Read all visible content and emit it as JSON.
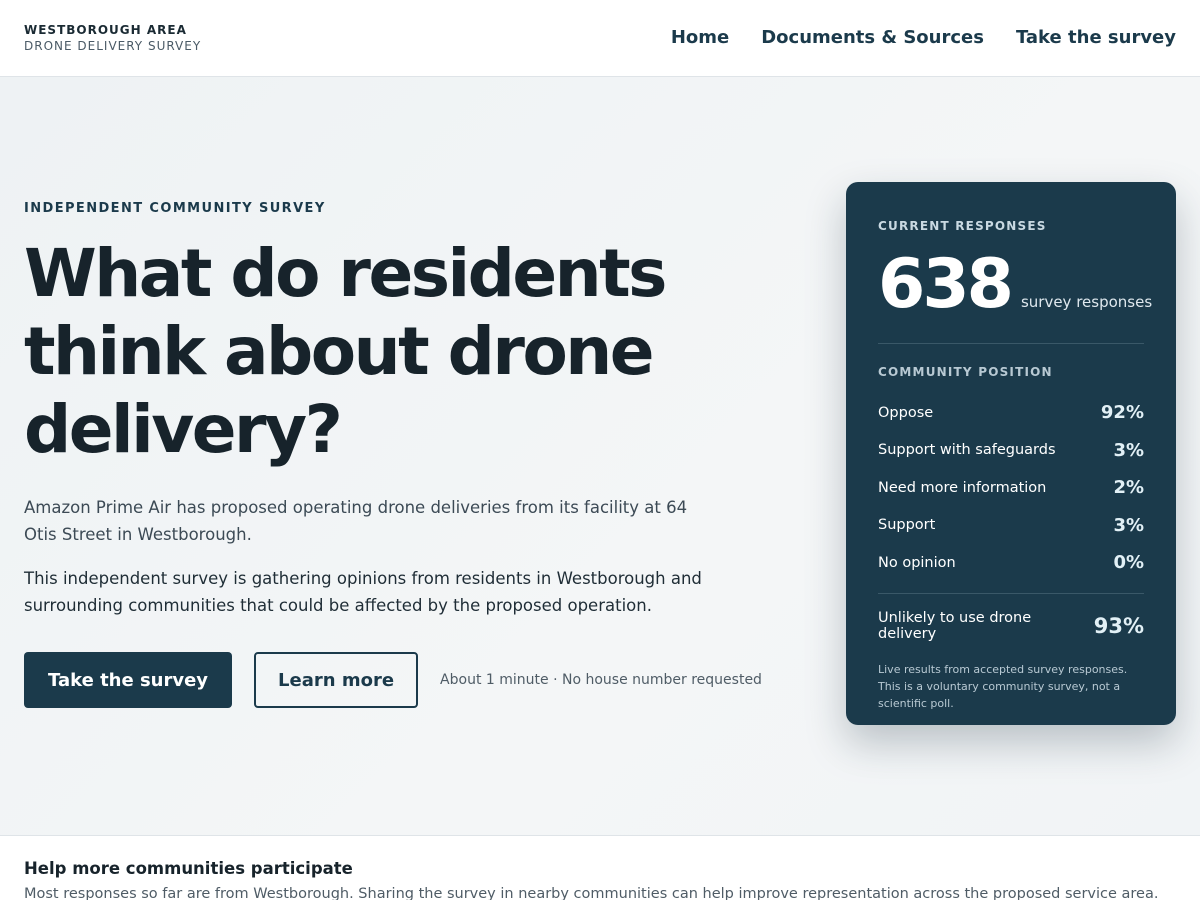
{
  "header": {
    "brand_line1": "WESTBOROUGH AREA",
    "brand_line2": "DRONE DELIVERY SURVEY",
    "nav": [
      "Home",
      "Documents & Sources",
      "Take the survey"
    ]
  },
  "hero": {
    "eyebrow": "INDEPENDENT COMMUNITY SURVEY",
    "headline": "What do residents think about drone delivery?",
    "lede": "Amazon Prime Air has proposed operating drone deliveries from its facility at 64 Otis Street in Westborough.",
    "lede2": "This independent survey is gathering opinions from residents in Westborough and surrounding communities that could be affected by the proposed operation.",
    "primary_button": "Take the survey",
    "secondary_button": "Learn more",
    "note": "About 1 minute · No house number requested"
  },
  "results": {
    "label": "CURRENT RESPONSES",
    "count": "638",
    "count_unit": "survey responses",
    "position_label": "COMMUNITY POSITION",
    "rows": [
      {
        "label": "Oppose",
        "value": "92%"
      },
      {
        "label": "Support with safeguards",
        "value": "3%"
      },
      {
        "label": "Need more information",
        "value": "2%"
      },
      {
        "label": "Support",
        "value": "3%"
      },
      {
        "label": "No opinion",
        "value": "0%"
      }
    ],
    "summary_label": "Unlikely to use drone delivery",
    "summary_value": "93%",
    "footnote": "Live results from accepted survey responses. This is a voluntary community survey, not a scientific poll."
  },
  "bottom": {
    "title": "Help more communities participate",
    "text": "Most responses so far are from Westborough. Sharing the survey in nearby communities can help improve representation across the proposed service area."
  },
  "colors": {
    "primary": "#1b3a4b",
    "text": "#17232b",
    "hero_background": "#f1f4f6"
  }
}
